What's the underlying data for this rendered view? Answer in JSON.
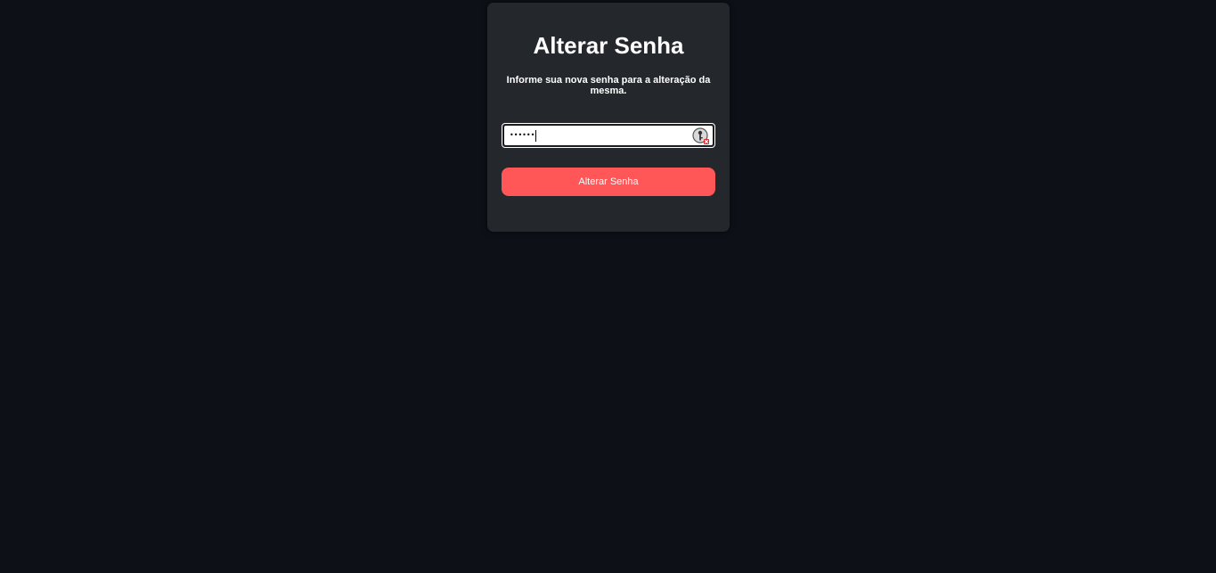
{
  "colors": {
    "background": "#0d1017",
    "card": "#24272c",
    "accent": "#ff5658",
    "text": "#ffffff"
  },
  "form": {
    "title": "Alterar Senha",
    "description": "Informe sua nova senha para a alteração da mesma.",
    "password_value": "••••••",
    "password_icon": "password-manager-key-icon",
    "submit_label": "Alterar Senha"
  }
}
